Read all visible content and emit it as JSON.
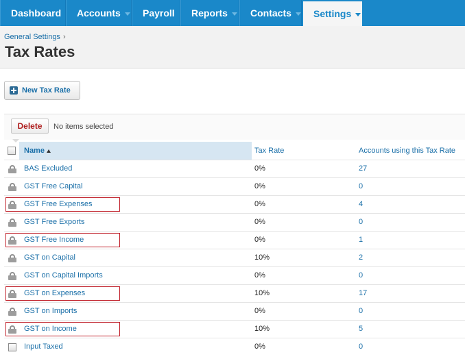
{
  "nav": {
    "items": [
      {
        "label": "Dashboard"
      },
      {
        "label": "Accounts"
      },
      {
        "label": "Payroll"
      },
      {
        "label": "Reports"
      },
      {
        "label": "Contacts"
      },
      {
        "label": "Settings"
      }
    ],
    "active": "Settings",
    "color": "#1a88c9"
  },
  "breadcrumb": {
    "label": "General Settings",
    "separator": "›"
  },
  "page": {
    "title": "Tax Rates"
  },
  "actions": {
    "new_label": "New Tax Rate",
    "delete_label": "Delete",
    "selection_status": "No items selected"
  },
  "table": {
    "columns": {
      "name": "Name",
      "rate": "Tax Rate",
      "accounts": "Accounts using this Tax Rate"
    },
    "rows": [
      {
        "name": "BAS Excluded",
        "rate": "0%",
        "accounts": "27",
        "icon": "lock-icon",
        "highlighted": false
      },
      {
        "name": "GST Free Capital",
        "rate": "0%",
        "accounts": "0",
        "icon": "lock-icon",
        "highlighted": false
      },
      {
        "name": "GST Free Expenses",
        "rate": "0%",
        "accounts": "4",
        "icon": "lock-icon",
        "highlighted": true
      },
      {
        "name": "GST Free Exports",
        "rate": "0%",
        "accounts": "0",
        "icon": "lock-icon",
        "highlighted": false
      },
      {
        "name": "GST Free Income",
        "rate": "0%",
        "accounts": "1",
        "icon": "lock-icon",
        "highlighted": true
      },
      {
        "name": "GST on Capital",
        "rate": "10%",
        "accounts": "2",
        "icon": "lock-icon",
        "highlighted": false
      },
      {
        "name": "GST on Capital Imports",
        "rate": "0%",
        "accounts": "0",
        "icon": "lock-icon",
        "highlighted": false
      },
      {
        "name": "GST on Expenses",
        "rate": "10%",
        "accounts": "17",
        "icon": "lock-icon",
        "highlighted": true
      },
      {
        "name": "GST on Imports",
        "rate": "0%",
        "accounts": "0",
        "icon": "lock-icon",
        "highlighted": false
      },
      {
        "name": "GST on Income",
        "rate": "10%",
        "accounts": "5",
        "icon": "lock-icon",
        "highlighted": true
      },
      {
        "name": "Input Taxed",
        "rate": "0%",
        "accounts": "0",
        "icon": "checkbox",
        "highlighted": false
      }
    ]
  }
}
